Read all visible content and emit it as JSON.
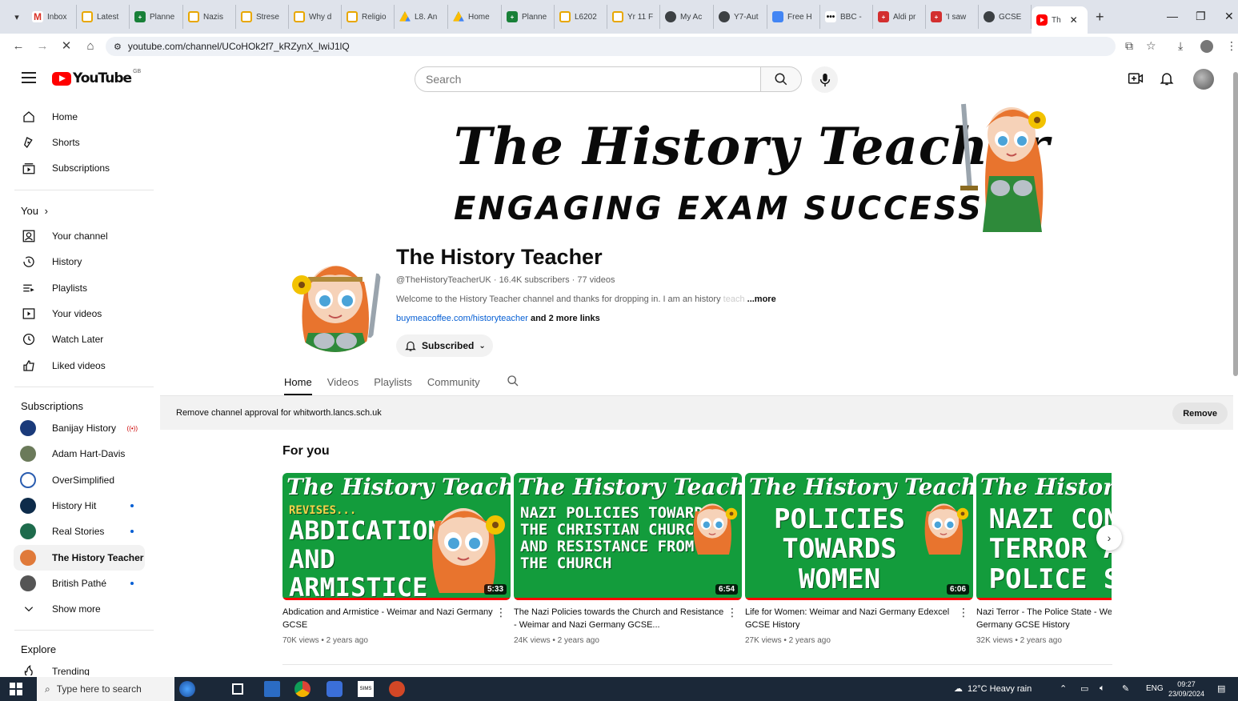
{
  "browser": {
    "tabs": [
      {
        "label": "Inbox",
        "icon": "gmail-icon"
      },
      {
        "label": "Latest",
        "icon": "yellow-square-icon"
      },
      {
        "label": "Planne",
        "icon": "green-plus-icon"
      },
      {
        "label": "Nazis",
        "icon": "yellow-square-icon"
      },
      {
        "label": "Strese",
        "icon": "yellow-square-icon"
      },
      {
        "label": "Why d",
        "icon": "yellow-square-icon"
      },
      {
        "label": "Religio",
        "icon": "yellow-square-icon"
      },
      {
        "label": "L8. An",
        "icon": "drive-icon"
      },
      {
        "label": "Home",
        "icon": "drive-icon"
      },
      {
        "label": "Planne",
        "icon": "green-plus-icon"
      },
      {
        "label": "L6202",
        "icon": "yellow-square-icon"
      },
      {
        "label": "Yr 11 F",
        "icon": "yellow-square-icon"
      },
      {
        "label": "My Ac",
        "icon": "circle-icon"
      },
      {
        "label": "Y7-Aut",
        "icon": "circle-icon"
      },
      {
        "label": "Free H",
        "icon": "grid-icon"
      },
      {
        "label": "BBC -",
        "icon": "dots-icon"
      },
      {
        "label": "Aldi pr",
        "icon": "red-plus-icon"
      },
      {
        "label": "'I saw",
        "icon": "red-plus-icon"
      },
      {
        "label": "GCSE",
        "icon": "circle-icon"
      },
      {
        "label": "Th",
        "icon": "youtube-icon",
        "active": true
      }
    ],
    "url": "youtube.com/channel/UCoHOk2f7_kRZynX_lwiJ1lQ"
  },
  "masthead": {
    "logo_text": "YouTube",
    "region": "GB",
    "search_placeholder": "Search"
  },
  "sidebar": {
    "main": [
      {
        "label": "Home",
        "icon": "home-icon"
      },
      {
        "label": "Shorts",
        "icon": "shorts-icon"
      },
      {
        "label": "Subscriptions",
        "icon": "subscriptions-icon"
      }
    ],
    "you_heading": "You",
    "you": [
      {
        "label": "Your channel",
        "icon": "your-channel-icon"
      },
      {
        "label": "History",
        "icon": "history-icon"
      },
      {
        "label": "Playlists",
        "icon": "playlists-icon"
      },
      {
        "label": "Your videos",
        "icon": "your-videos-icon"
      },
      {
        "label": "Watch Later",
        "icon": "watch-later-icon"
      },
      {
        "label": "Liked videos",
        "icon": "liked-icon"
      }
    ],
    "subscriptions_heading": "Subscriptions",
    "subscriptions": [
      {
        "label": "Banijay History",
        "color": "#1a3a7a",
        "indicator": "live"
      },
      {
        "label": "Adam Hart-Davis",
        "color": "#6b7a5a",
        "indicator": ""
      },
      {
        "label": "OverSimplified",
        "color": "#2a5db0",
        "indicator": ""
      },
      {
        "label": "History Hit",
        "color": "#0d2b4a",
        "indicator": "new"
      },
      {
        "label": "Real Stories",
        "color": "#1e6b4c",
        "indicator": "new"
      },
      {
        "label": "The History Teacher",
        "color": "#e07a3a",
        "indicator": ""
      },
      {
        "label": "British Pathé",
        "color": "#555555",
        "indicator": "new"
      }
    ],
    "show_more": "Show more",
    "explore_heading": "Explore",
    "explore": [
      {
        "label": "Trending",
        "icon": "trending-icon"
      }
    ]
  },
  "banner": {
    "title": "The History Teacher",
    "subtitle": "ENGAGING EXAM SUCCESS"
  },
  "channel": {
    "name": "The History Teacher",
    "handle": "@TheHistoryTeacherUK",
    "subscribers": "16.4K subscribers",
    "videos_count": "77 videos",
    "description": "Welcome to the History Teacher channel and thanks for dropping in. I am an history",
    "description_fade": "teach",
    "more": "...more",
    "link": "buymeacoffee.com/historyteacher",
    "more_links": "and 2 more links",
    "subscribed_label": "Subscribed"
  },
  "tabs": [
    "Home",
    "Videos",
    "Playlists",
    "Community"
  ],
  "approval": {
    "text": "Remove channel approval for whitworth.lancs.sch.uk",
    "button": "Remove"
  },
  "shelf": {
    "title": "For you",
    "videos": [
      {
        "title": "Abdication and Armistice - Weimar and Nazi Germany GCSE",
        "views": "70K views",
        "age": "2 years ago",
        "duration": "5:33",
        "thumb_script": "The History Teacher",
        "thumb_lines": [
          "REVISES...",
          "ABDICATION",
          "AND",
          "ARMISTICE"
        ]
      },
      {
        "title": "The Nazi Policies towards the Church and Resistance - Weimar and Nazi Germany GCSE...",
        "views": "24K views",
        "age": "2 years ago",
        "duration": "6:54",
        "thumb_script": "The History Teacher",
        "thumb_lines": [
          "NAZI POLICIES TOWARDS",
          "THE CHRISTIAN CHURCH",
          "AND RESISTANCE FROM",
          "THE CHURCH"
        ]
      },
      {
        "title": "Life for Women: Weimar and Nazi Germany Edexcel GCSE History",
        "views": "27K views",
        "age": "2 years ago",
        "duration": "6:06",
        "thumb_script": "The History Teacher",
        "thumb_lines": [
          "POLICIES",
          "TOWARDS",
          "WOMEN"
        ]
      },
      {
        "title": "Nazi Terror - The Police State - Weimar and Nazi Germany GCSE History",
        "views": "32K views",
        "age": "2 years ago",
        "duration": "",
        "thumb_script": "The History",
        "thumb_lines": [
          "NAZI CONTR",
          "TERROR AND",
          "POLICE STA"
        ]
      }
    ]
  },
  "taskbar": {
    "search_placeholder": "Type here to search",
    "weather": "12°C  Heavy rain",
    "language": "ENG",
    "time": "09:27",
    "date": "23/09/2024"
  }
}
